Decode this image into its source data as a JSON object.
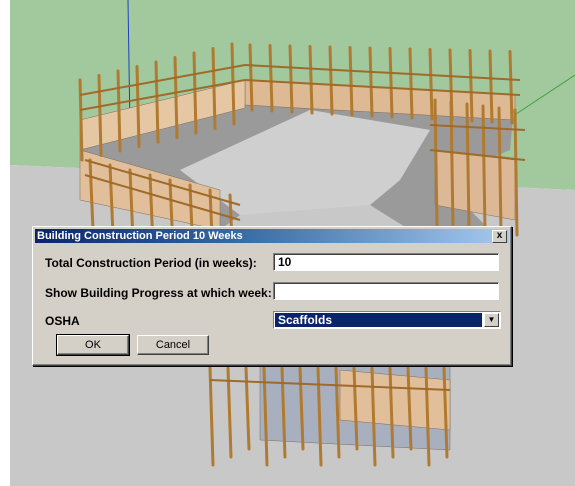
{
  "dialog": {
    "title": "Building Construction Period 10 Weeks",
    "close_label": "x",
    "fields": {
      "total_period_label": "Total Construction Period (in weeks):",
      "total_period_value": "10",
      "show_progress_label": "Show Building Progress at which week:",
      "show_progress_value": "",
      "osha_label": "OSHA",
      "osha_value": "Scaffolds"
    },
    "buttons": {
      "ok": "OK",
      "cancel": "Cancel"
    }
  },
  "scene": {
    "colors": {
      "sky": "#9fc79a",
      "ground": "#c8c8c8",
      "slab": "#a0a0a0",
      "wall": "#e0c3a0",
      "post": "#c08a40"
    }
  }
}
